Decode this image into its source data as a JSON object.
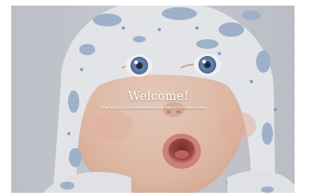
{
  "hero": {
    "title": "Welcome!",
    "subtitle": "Improving the Care of Newborns and Infants in the State of Iowa",
    "image_subject": "surprised baby wearing white hat with blue cloud pattern"
  },
  "colors": {
    "page_background": "#ffffff",
    "hero_background": "#cfd2d9",
    "skin": "#eec9b6",
    "hat": "#f2f3f6",
    "hat_pattern": "#a9bbd6",
    "eyes": "#6e8fbf",
    "text": "#ffffff"
  }
}
